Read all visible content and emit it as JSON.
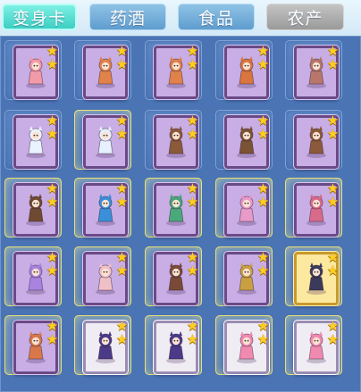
{
  "tabs": [
    {
      "label": "变身卡",
      "state": "active"
    },
    {
      "label": "药酒",
      "state": "normal"
    },
    {
      "label": "食品",
      "state": "normal"
    },
    {
      "label": "农产",
      "state": "disabled"
    }
  ],
  "colors": {
    "panel": "#4a74b4",
    "tab_active": "#3ccfc3",
    "tab_normal": "#5f9dcf",
    "tab_disabled": "#9a9a9a",
    "star": "#ffcf1f"
  },
  "star_glyph": "★",
  "cards": [
    {
      "icon": "pink-creature-card-icon",
      "stars": 2,
      "frame": "purple",
      "glow": false,
      "art": "#f29aa8"
    },
    {
      "icon": "fox-warrior-card-icon",
      "stars": 2,
      "frame": "purple",
      "glow": false,
      "art": "#e0824a"
    },
    {
      "icon": "fox-warrior-card-icon",
      "stars": 2,
      "frame": "purple",
      "glow": false,
      "art": "#e0824a"
    },
    {
      "icon": "fox-warrior-card-icon",
      "stars": 2,
      "frame": "purple",
      "glow": false,
      "art": "#d9753e"
    },
    {
      "icon": "boar-card-icon",
      "stars": 2,
      "frame": "purple",
      "glow": false,
      "art": "#b8776a"
    },
    {
      "icon": "white-rabbit-card-icon",
      "stars": 2,
      "frame": "purple",
      "glow": false,
      "art": "#eaf2ff"
    },
    {
      "icon": "white-rabbit-card-icon",
      "stars": 2,
      "frame": "purple",
      "glow": true,
      "art": "#e6f0ff"
    },
    {
      "icon": "armored-warrior-card-icon",
      "stars": 2,
      "frame": "purple",
      "glow": false,
      "art": "#8a5a3a"
    },
    {
      "icon": "armored-warrior-card-icon",
      "stars": 2,
      "frame": "purple",
      "glow": false,
      "art": "#7a5234"
    },
    {
      "icon": "armored-warrior-card-icon",
      "stars": 2,
      "frame": "purple",
      "glow": false,
      "art": "#8a5a3a"
    },
    {
      "icon": "armored-warrior-card-icon",
      "stars": 2,
      "frame": "purple",
      "glow": true,
      "art": "#6e4a30"
    },
    {
      "icon": "blue-dragon-knight-card-icon",
      "stars": 2,
      "frame": "purple",
      "glow": true,
      "art": "#3a8fd8"
    },
    {
      "icon": "green-swordsman-card-icon",
      "stars": 2,
      "frame": "purple",
      "glow": true,
      "art": "#4aa87a"
    },
    {
      "icon": "fairy-umbrella-card-icon",
      "stars": 2,
      "frame": "purple",
      "glow": true,
      "art": "#e89ac8"
    },
    {
      "icon": "pink-warrior-card-icon",
      "stars": 2,
      "frame": "purple",
      "glow": true,
      "art": "#d86a8a"
    },
    {
      "icon": "purple-fox-card-icon",
      "stars": 2,
      "frame": "purple",
      "glow": true,
      "art": "#a884e0"
    },
    {
      "icon": "winged-girl-card-icon",
      "stars": 2,
      "frame": "purple",
      "glow": true,
      "art": "#f0c0c8"
    },
    {
      "icon": "armored-warrior-card-icon",
      "stars": 2,
      "frame": "purple",
      "glow": true,
      "art": "#7a4a38"
    },
    {
      "icon": "golden-general-card-icon",
      "stars": 2,
      "frame": "purple",
      "glow": true,
      "art": "#c8a040"
    },
    {
      "icon": "rabbit-mage-card-icon",
      "stars": 2,
      "frame": "gold",
      "glow": true,
      "art": "#3a3a5a"
    },
    {
      "icon": "pink-warrior-card-icon",
      "stars": 2,
      "frame": "purple",
      "glow": true,
      "art": "#d8784a"
    },
    {
      "icon": "ninja-card-icon",
      "stars": 2,
      "frame": "white",
      "glow": true,
      "art": "#4a3a88"
    },
    {
      "icon": "ninja-card-icon",
      "stars": 2,
      "frame": "white",
      "glow": true,
      "art": "#4a3a88"
    },
    {
      "icon": "pink-hair-girl-card-icon",
      "stars": 2,
      "frame": "white",
      "glow": true,
      "art": "#f08ab0"
    },
    {
      "icon": "pink-hair-girl-card-icon",
      "stars": 2,
      "frame": "white",
      "glow": true,
      "art": "#f08ab0"
    }
  ]
}
